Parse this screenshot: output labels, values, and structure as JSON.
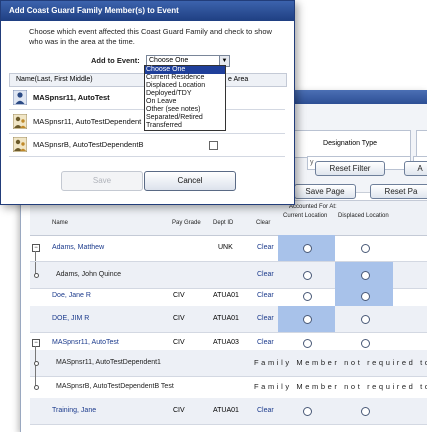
{
  "dialog": {
    "title": "Add Coast Guard Family Member(s) to Event",
    "instructions": "Choose which event affected this Coast Guard Family and check to show who was in the area at the time.",
    "add_to_event_label": "Add to Event:",
    "select_value": "Choose One",
    "table_head_name": "Name(Last, First Middle)",
    "table_head_area": "e Area",
    "rows": [
      {
        "name": "MASpnsr11, AutoTest",
        "bold": true
      },
      {
        "name": "MASpnsr11, AutoTestDependent",
        "bold": false
      },
      {
        "name": "MASpnsrB, AutoTestDependentB",
        "bold": false
      }
    ],
    "save_label": "Save",
    "cancel_label": "Cancel"
  },
  "dropdown": {
    "options": [
      "Choose One",
      "Current Residence",
      "Displaced Location",
      "Deployed/TDY",
      "On Leave",
      "Other (see notes)",
      "Separated/Retired",
      "Transferred"
    ]
  },
  "background": {
    "designation_type_label": "Designation Type",
    "reset_filter_label": "Reset Filter",
    "a_label": "A",
    "save_page_label": "Save Page",
    "reset_page_label": "Reset Pa",
    "accounted_for_label": "Accounted For At:",
    "columns": {
      "name": "Name",
      "pay_grade": "Pay Grade",
      "dept_id": "Dept ID",
      "clear": "Clear",
      "current_location": "Current Location",
      "displaced_location": "Displaced Location"
    },
    "rows": [
      {
        "name": "Adams, Matthew",
        "pay": "",
        "dept": "UNK",
        "clear": "Clear"
      },
      {
        "name": "Adams, John Quince",
        "pay": "",
        "dept": "",
        "clear": "Clear"
      },
      {
        "name": "Doe, Jane R",
        "pay": "CIV",
        "dept": "ATUA01",
        "clear": "Clear"
      },
      {
        "name": "DOE, JIM R",
        "pay": "CIV",
        "dept": "ATUA01",
        "clear": "Clear"
      },
      {
        "name": "MASpnsr11, AutoTest",
        "pay": "CIV",
        "dept": "ATUA03",
        "clear": "Clear"
      },
      {
        "name": "MASpnsr11, AutoTestDependent1",
        "pay": "",
        "dept": "",
        "clear": ""
      },
      {
        "name": "MASpnsrB, AutoTestDependentB Test",
        "pay": "",
        "dept": "",
        "clear": ""
      },
      {
        "name": "Training, Jane",
        "pay": "CIV",
        "dept": "ATUA01",
        "clear": "Clear"
      }
    ],
    "family_msg": "Family   Member   not   required   to"
  },
  "colors": {
    "title_bar": "#2a4d92",
    "selected_option": "#1f3f9a",
    "highlight_cell": "#a8c2ea",
    "link": "#1b3a8c"
  }
}
